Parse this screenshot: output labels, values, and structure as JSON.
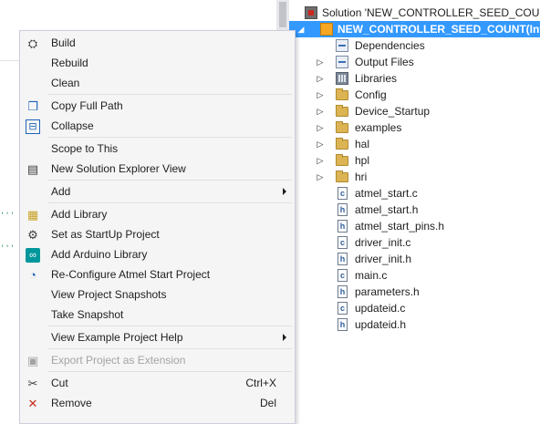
{
  "editor": {
    "dots": [
      "'''",
      "'''"
    ]
  },
  "solution_explorer": {
    "solution_label": "Solution 'NEW_CONTROLLER_SEED_COUN",
    "project_label": "NEW_CONTROLLER_SEED_COUNT(Int",
    "items": [
      {
        "label": "Dependencies",
        "icon": "dependencies-icon",
        "expandable": false
      },
      {
        "label": "Output Files",
        "icon": "output-files-icon",
        "expandable": true
      },
      {
        "label": "Libraries",
        "icon": "libraries-icon",
        "expandable": true
      },
      {
        "label": "Config",
        "icon": "folder-icon",
        "expandable": true
      },
      {
        "label": "Device_Startup",
        "icon": "folder-icon",
        "expandable": true
      },
      {
        "label": "examples",
        "icon": "folder-icon",
        "expandable": true
      },
      {
        "label": "hal",
        "icon": "folder-icon",
        "expandable": true
      },
      {
        "label": "hpl",
        "icon": "folder-icon",
        "expandable": true
      },
      {
        "label": "hri",
        "icon": "folder-icon",
        "expandable": true
      },
      {
        "label": "atmel_start.c",
        "icon": "c-file-icon",
        "glyph": "c"
      },
      {
        "label": "atmel_start.h",
        "icon": "h-file-icon",
        "glyph": "h"
      },
      {
        "label": "atmel_start_pins.h",
        "icon": "h-file-icon",
        "glyph": "h"
      },
      {
        "label": "driver_init.c",
        "icon": "c-file-icon",
        "glyph": "c"
      },
      {
        "label": "driver_init.h",
        "icon": "h-file-icon",
        "glyph": "h"
      },
      {
        "label": "main.c",
        "icon": "c-file-icon",
        "glyph": "c"
      },
      {
        "label": "parameters.h",
        "icon": "h-file-icon",
        "glyph": "h"
      },
      {
        "label": "updateid.c",
        "icon": "c-file-icon",
        "glyph": "c"
      },
      {
        "label": "updateid.h",
        "icon": "h-file-icon",
        "glyph": "h"
      }
    ]
  },
  "context_menu": {
    "items": [
      {
        "label": "Build",
        "icon": "build-icon"
      },
      {
        "label": "Rebuild"
      },
      {
        "label": "Clean"
      },
      {
        "label": "Copy Full Path",
        "icon": "copy-icon"
      },
      {
        "label": "Collapse",
        "icon": "collapse-icon"
      },
      {
        "label": "Scope to This"
      },
      {
        "label": "New Solution Explorer View",
        "icon": "new-view-icon"
      },
      {
        "label": "Add",
        "submenu": true
      },
      {
        "label": "Add Library",
        "icon": "add-library-icon"
      },
      {
        "label": "Set as StartUp Project",
        "icon": "gear-icon"
      },
      {
        "label": "Add Arduino Library",
        "icon": "arduino-icon"
      },
      {
        "label": "Re-Configure Atmel Start Project",
        "icon": "atmel-start-icon"
      },
      {
        "label": "View Project Snapshots"
      },
      {
        "label": "Take Snapshot"
      },
      {
        "label": "View Example Project Help",
        "submenu": true
      },
      {
        "label": "Export Project as Extension",
        "icon": "export-icon",
        "disabled": true
      },
      {
        "label": "Cut",
        "icon": "scissors-icon",
        "shortcut": "Ctrl+X"
      },
      {
        "label": "Remove",
        "icon": "remove-icon",
        "shortcut": "Del"
      }
    ]
  },
  "colors": {
    "selection": "#3399ff",
    "menu_background": "#f5f5f5",
    "menu_border": "#cccedb",
    "folder": "#dcb454"
  }
}
